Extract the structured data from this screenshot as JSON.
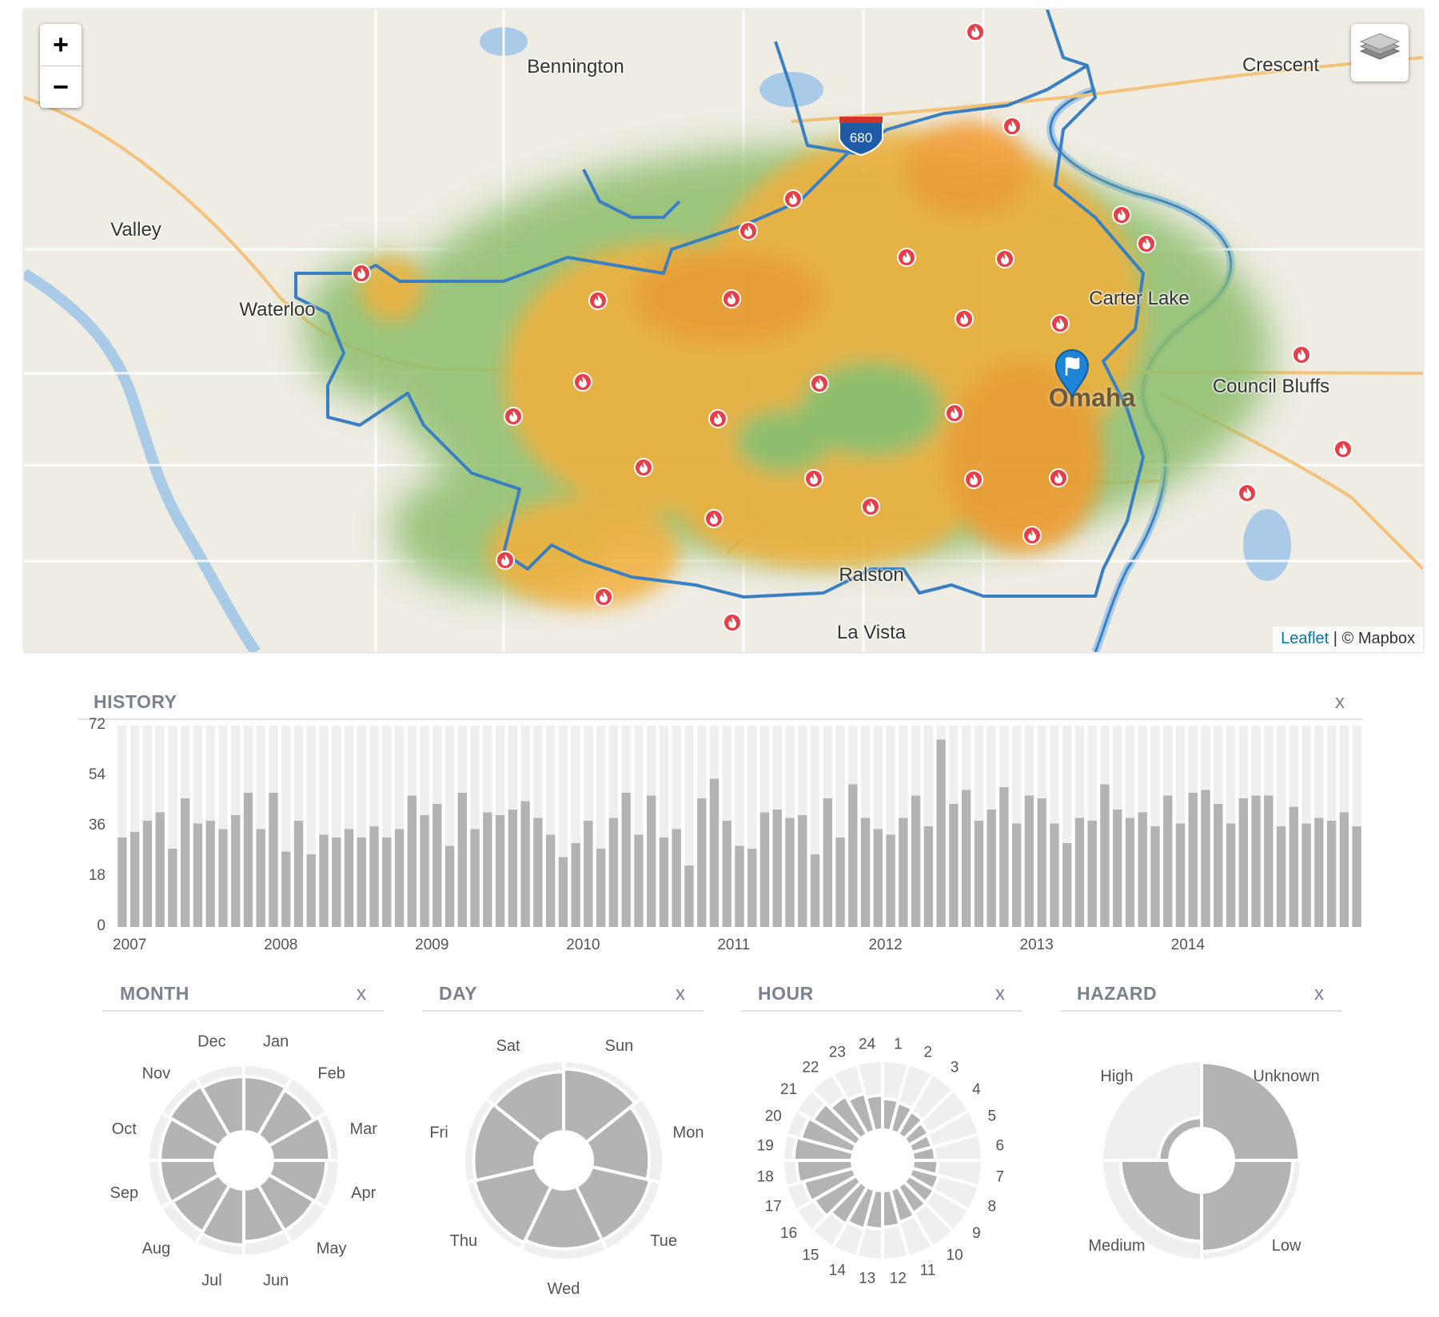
{
  "map": {
    "places": [
      {
        "name": "Bennington",
        "x": 690,
        "y": 72,
        "big": false
      },
      {
        "name": "Crescent",
        "x": 1572,
        "y": 70,
        "big": false
      },
      {
        "name": "Valley",
        "x": 140,
        "y": 276,
        "big": false
      },
      {
        "name": "Waterloo",
        "x": 317,
        "y": 376,
        "big": false
      },
      {
        "name": "Carter Lake",
        "x": 1395,
        "y": 362,
        "big": false
      },
      {
        "name": "Omaha",
        "x": 1336,
        "y": 486,
        "big": true
      },
      {
        "name": "Council Bluffs",
        "x": 1560,
        "y": 472,
        "big": false
      },
      {
        "name": "Ralston",
        "x": 1060,
        "y": 708,
        "big": false
      },
      {
        "name": "La Vista",
        "x": 1060,
        "y": 780,
        "big": false
      }
    ],
    "highway_shield": "680",
    "zoom_in_label": "+",
    "zoom_out_label": "−",
    "attribution_link": "Leaflet",
    "attribution_text": " | © Mapbox",
    "heat_colors": {
      "low": "#8dbe6c",
      "mid": "#f2b03c",
      "high": "#f59a2e"
    },
    "boundary_color": "#3a7fc1",
    "marker_color": "#1f84d6",
    "fire_icon_color": "#e5404a"
  },
  "history": {
    "title": "HISTORY",
    "close": "x",
    "y_ticks": [
      "72",
      "54",
      "36",
      "18",
      "0"
    ],
    "x_ticks": [
      "2007",
      "2008",
      "2009",
      "2010",
      "2011",
      "2012",
      "2013",
      "2014"
    ]
  },
  "month": {
    "title": "MONTH",
    "close": "x"
  },
  "day": {
    "title": "DAY",
    "close": "x"
  },
  "hour": {
    "title": "HOUR",
    "close": "x"
  },
  "hazard": {
    "title": "HAZARD",
    "close": "x"
  },
  "chart_data": [
    {
      "type": "bar",
      "title": "HISTORY",
      "x_start": "2007-01",
      "x_interval": "month",
      "ylim": [
        0,
        72
      ],
      "values": [
        32,
        34,
        38,
        41,
        28,
        46,
        37,
        38,
        35,
        40,
        48,
        35,
        48,
        27,
        38,
        26,
        33,
        32,
        35,
        32,
        36,
        32,
        35,
        47,
        40,
        44,
        29,
        48,
        35,
        41,
        40,
        42,
        45,
        39,
        33,
        25,
        30,
        38,
        28,
        39,
        48,
        33,
        47,
        32,
        35,
        22,
        46,
        53,
        38,
        29,
        28,
        41,
        42,
        39,
        40,
        26,
        46,
        32,
        51,
        39,
        35,
        33,
        39,
        47,
        36,
        67,
        44,
        49,
        38,
        42,
        50,
        37,
        47,
        46,
        37,
        30,
        39,
        38,
        51,
        42,
        39,
        41,
        36,
        47,
        37,
        48,
        49,
        44,
        37,
        46,
        47,
        47,
        36,
        43,
        37,
        39,
        38,
        41,
        36
      ],
      "note": "monthly incident counts"
    },
    {
      "type": "radial",
      "title": "MONTH",
      "categories": [
        "Jan",
        "Feb",
        "Mar",
        "Apr",
        "May",
        "Jun",
        "Jul",
        "Aug",
        "Sep",
        "Oct",
        "Nov",
        "Dec"
      ],
      "values": [
        0.82,
        0.78,
        0.85,
        0.8,
        0.78,
        0.78,
        0.83,
        0.8,
        0.82,
        0.82,
        0.85,
        0.82
      ]
    },
    {
      "type": "radial",
      "title": "DAY",
      "categories": [
        "Sun",
        "Mon",
        "Tue",
        "Wed",
        "Thu",
        "Fri",
        "Sat"
      ],
      "values": [
        0.88,
        0.8,
        0.84,
        0.84,
        0.88,
        0.86,
        0.84
      ]
    },
    {
      "type": "radial",
      "title": "HOUR",
      "categories": [
        "1",
        "2",
        "3",
        "4",
        "5",
        "6",
        "7",
        "8",
        "9",
        "10",
        "11",
        "12",
        "13",
        "14",
        "15",
        "16",
        "17",
        "18",
        "19",
        "20",
        "21",
        "22",
        "23",
        "24"
      ],
      "values": [
        0.45,
        0.42,
        0.38,
        0.33,
        0.3,
        0.32,
        0.36,
        0.4,
        0.42,
        0.44,
        0.48,
        0.52,
        0.55,
        0.58,
        0.62,
        0.7,
        0.74,
        0.8,
        0.84,
        0.78,
        0.72,
        0.63,
        0.56,
        0.5
      ]
    },
    {
      "type": "radial",
      "title": "HAZARD",
      "categories": [
        "Unknown",
        "Low",
        "Medium",
        "High"
      ],
      "values": [
        0.97,
        0.87,
        0.72,
        0.16
      ]
    }
  ]
}
